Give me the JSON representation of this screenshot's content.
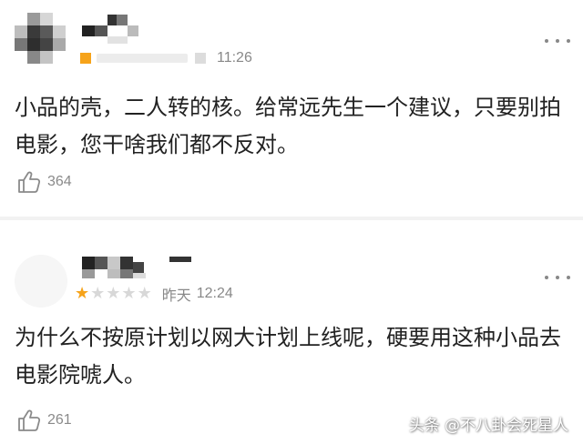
{
  "comments": [
    {
      "timestamp": "11:26",
      "text": "小品的壳，二人转的核。给常远先生一个建议，只要别拍电影，您干啥我们都不反对。",
      "likes": "364"
    },
    {
      "rating": 1,
      "rating_max": 5,
      "date_label": "昨天",
      "timestamp": "12:24",
      "text": "为什么不按原计划以网大计划上线呢，硬要用这种小品去电影院唬人。",
      "likes": "261"
    }
  ],
  "watermark": "头条 @不八卦会死星人",
  "colors": {
    "star_filled": "#f6a31a",
    "star_empty": "#d8d8d8",
    "level_badge": "#f6a31a",
    "muted_text": "#888888"
  },
  "icons": {
    "more": "more-dots-icon",
    "like": "thumbs-up-icon",
    "star": "star-icon"
  }
}
